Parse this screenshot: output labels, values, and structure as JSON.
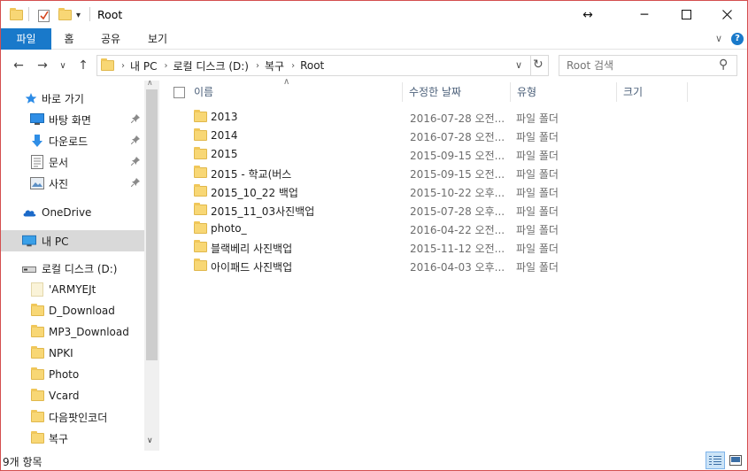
{
  "window": {
    "title": "Root",
    "resize_glyph": "↔",
    "minimize_glyph": "─",
    "maximize_glyph": "☐",
    "close_glyph": "✕"
  },
  "ribbon": {
    "tabs": [
      {
        "label": "파일"
      },
      {
        "label": "홈"
      },
      {
        "label": "공유"
      },
      {
        "label": "보기"
      }
    ],
    "expand_glyph": "∨",
    "help_glyph": "?"
  },
  "address": {
    "crumbs": [
      "내 PC",
      "로컬 디스크 (D:)",
      "복구",
      "Root"
    ],
    "separator": "›",
    "dropdown_glyph": "∨",
    "refresh_glyph": "↻"
  },
  "search": {
    "placeholder": "Root 검색",
    "icon_glyph": "⚲"
  },
  "nav": {
    "back_glyph": "←",
    "forward_glyph": "→",
    "recent_glyph": "∨",
    "up_glyph": "↑",
    "quick_access": {
      "label": "바로 가기"
    },
    "pinned": [
      {
        "label": "바탕 화면",
        "icon": "desktop-icon"
      },
      {
        "label": "다운로드",
        "icon": "download-icon"
      },
      {
        "label": "문서",
        "icon": "document-icon"
      },
      {
        "label": "사진",
        "icon": "pictures-icon"
      }
    ],
    "pin_glyph": "📌",
    "onedrive": {
      "label": "OneDrive"
    },
    "this_pc": {
      "label": "내 PC"
    },
    "drive": {
      "label": "로컬 디스크 (D:)"
    },
    "drive_children": [
      {
        "label": "'ARMYEJt"
      },
      {
        "label": "D_Download"
      },
      {
        "label": "MP3_Download"
      },
      {
        "label": "NPKI"
      },
      {
        "label": "Photo"
      },
      {
        "label": "Vcard"
      },
      {
        "label": "다음팟인코더"
      },
      {
        "label": "복구"
      }
    ],
    "scroll_up_glyph": "∧",
    "scroll_down_glyph": "∨"
  },
  "columns": {
    "name": "이름",
    "modified": "수정한 날짜",
    "type": "유형",
    "size": "크기",
    "sort_glyph": "∧"
  },
  "files": [
    {
      "name": "2013",
      "date": "2016-07-28 오전...",
      "type": "파일 폴더"
    },
    {
      "name": "2014",
      "date": "2016-07-28 오전...",
      "type": "파일 폴더"
    },
    {
      "name": "2015",
      "date": "2015-09-15 오전...",
      "type": "파일 폴더"
    },
    {
      "name": "2015 - 학교(버스",
      "date": "2015-09-15 오전...",
      "type": "파일 폴더"
    },
    {
      "name": "2015_10_22 백업",
      "date": "2015-10-22 오후...",
      "type": "파일 폴더"
    },
    {
      "name": "2015_11_03사진백업",
      "date": "2015-07-28 오후...",
      "type": "파일 폴더"
    },
    {
      "name": "photo_",
      "date": "2016-04-22 오전...",
      "type": "파일 폴더"
    },
    {
      "name": "블랙베리 사진백업",
      "date": "2015-11-12 오전...",
      "type": "파일 폴더"
    },
    {
      "name": "아이패드 사진백업",
      "date": "2016-04-03 오후...",
      "type": "파일 폴더"
    }
  ],
  "status": {
    "item_count": "9개 항목"
  },
  "colors": {
    "accent": "#1979ca",
    "folder": "#f8d775",
    "window_border": "#d44f4f",
    "selected": "#d9d9d9"
  }
}
